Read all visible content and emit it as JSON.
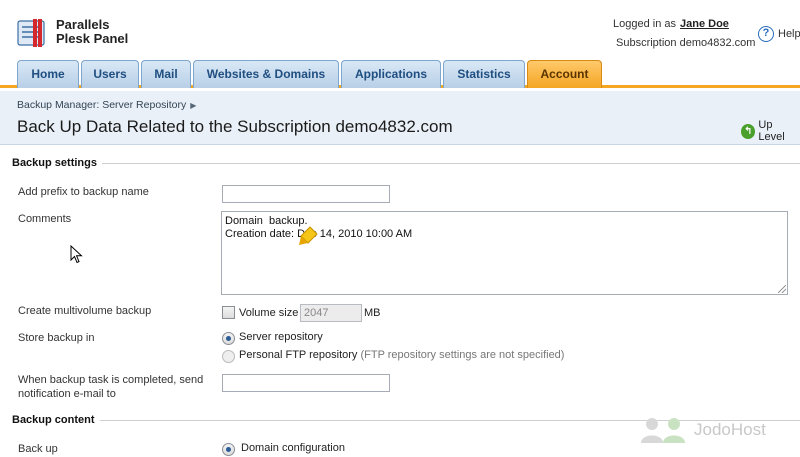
{
  "header": {
    "product_line1": "Parallels",
    "product_line2": "Plesk Panel",
    "logged_in_prefix": "Logged in as",
    "user_name": "Jane Doe",
    "subscription_text": "Subscription demo4832.com",
    "help_label": "Help"
  },
  "tabs": [
    {
      "label": "Home",
      "active": false
    },
    {
      "label": "Users",
      "active": false
    },
    {
      "label": "Mail",
      "active": false
    },
    {
      "label": "Websites & Domains",
      "active": false
    },
    {
      "label": "Applications",
      "active": false
    },
    {
      "label": "Statistics",
      "active": false
    },
    {
      "label": "Account",
      "active": true
    }
  ],
  "breadcrumb": "Backup Manager: Server Repository",
  "page_title": "Back Up Data Related to the Subscription demo4832.com",
  "up_level_label": "Up Level",
  "backup_settings": {
    "section_title": "Backup settings",
    "prefix_label": "Add prefix to backup name",
    "prefix_value": "",
    "comments_label": "Comments",
    "comments_line1": "Domain  backup.",
    "comments_line2": "Creation date: Dec 14, 2010 10:00 AM",
    "multivolume_label": "Create multivolume backup",
    "volume_size_label": "Volume size",
    "volume_size_value": "2047",
    "volume_unit": "MB",
    "store_label": "Store backup in",
    "store_option_server": "Server repository",
    "store_option_ftp": "Personal FTP repository",
    "ftp_note": "(FTP repository settings are not specified)",
    "notify_label_line1": "When backup task is completed, send",
    "notify_label_line2": "notification e-mail to",
    "notify_value": ""
  },
  "backup_content": {
    "section_title": "Backup content",
    "backup_label": "Back up",
    "option_domain_config": "Domain configuration"
  },
  "watermark_text": "JodoHost",
  "colors": {
    "tab_blue": "#b7cfe6",
    "tab_active": "#f5a623",
    "subheader_bg": "#e9f0f7",
    "uplevel_green": "#4aa02c"
  }
}
